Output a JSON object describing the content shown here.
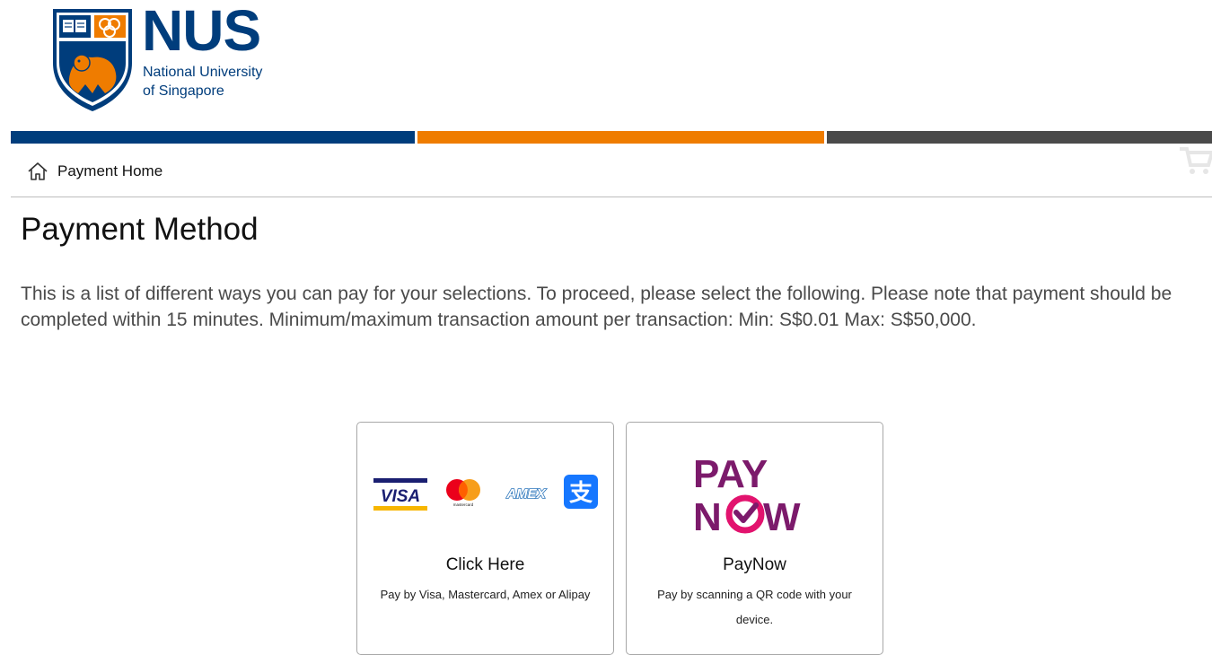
{
  "logo": {
    "wordmark": "NUS",
    "line1": "National University",
    "line2": "of Singapore"
  },
  "brand_colors": {
    "nus_blue": "#003d7c",
    "nus_orange": "#ef7c00",
    "dark_gray": "#4a4a4a",
    "paynow_purple": "#7c1a6b",
    "paynow_check": "#e2136e"
  },
  "breadcrumb": {
    "icon": "home-icon",
    "label": "Payment Home"
  },
  "page": {
    "title": "Payment Method",
    "intro": "This is a list of different ways you can pay for your selections. To proceed, please select the following. Please note that payment should be completed within 15 minutes. Minimum/maximum transaction amount per transaction: Min: S$0.01 Max: S$50,000."
  },
  "methods": [
    {
      "title": "Click Here",
      "description": "Pay by Visa, Mastercard, Amex or Alipay",
      "logos": [
        "visa-logo",
        "mastercard-logo",
        "amex-logo",
        "alipay-logo"
      ],
      "logo_text": {
        "visa": "VISA",
        "mastercard": "mastercard",
        "amex": "AMEX",
        "alipay": "支"
      }
    },
    {
      "title": "PayNow",
      "description": "Pay by scanning a QR code with your device.",
      "logos": [
        "paynow-logo"
      ],
      "logo_text": {
        "top": "PAY",
        "bottom_left": "N",
        "bottom_right": "W"
      }
    }
  ]
}
